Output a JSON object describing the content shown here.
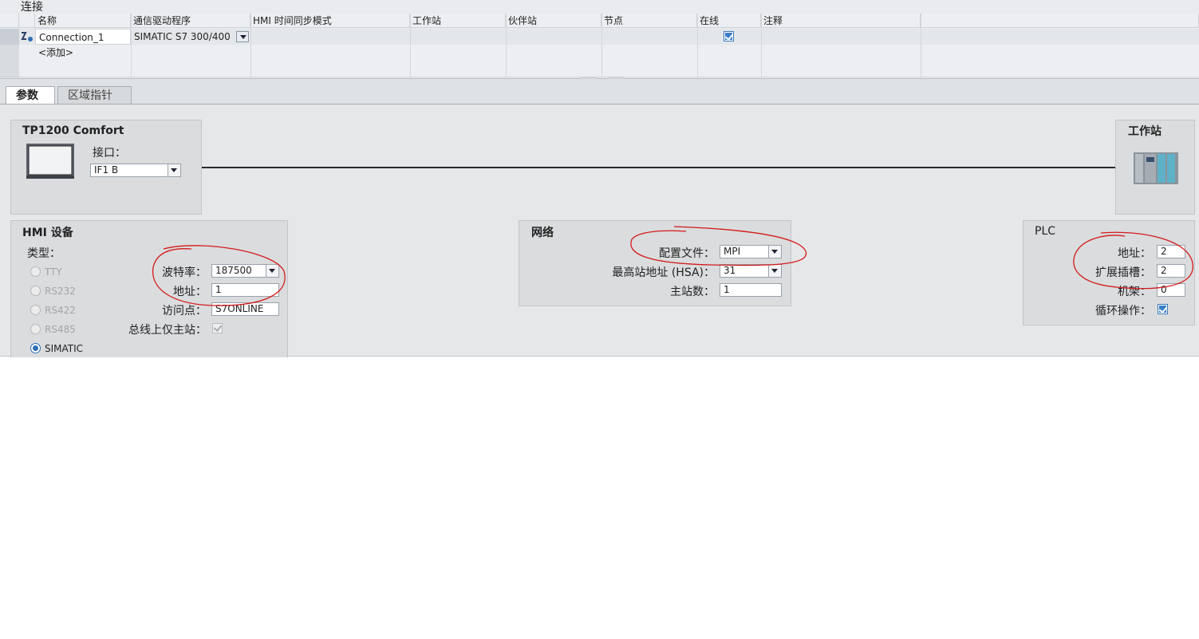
{
  "top": {
    "title": "连接",
    "columns": [
      "名称",
      "通信驱动程序",
      "HMI 时间同步模式",
      "工作站",
      "伙伴站",
      "节点",
      "在线",
      "注释"
    ],
    "rows": [
      {
        "name": "Connection_1",
        "driver": "SIMATIC S7 300/400",
        "online": true
      },
      {
        "name": "<添加>"
      }
    ]
  },
  "tabs": [
    {
      "label": "参数",
      "active": true
    },
    {
      "label": "区域指针",
      "active": false
    }
  ],
  "device": {
    "title": "TP1200 Comfort",
    "interface_label": "接口：",
    "interface_value": "IF1 B"
  },
  "station": {
    "title": "工作站"
  },
  "hmi": {
    "title": "HMI 设备",
    "type_label": "类型：",
    "types": [
      {
        "label": "TTY",
        "selected": false
      },
      {
        "label": "RS232",
        "selected": false
      },
      {
        "label": "RS422",
        "selected": false
      },
      {
        "label": "RS485",
        "selected": false
      },
      {
        "label": "SIMATIC",
        "selected": true
      }
    ],
    "baud_label": "波特率：",
    "baud_value": "187500",
    "address_label": "地址：",
    "address_value": "1",
    "access_label": "访问点：",
    "access_value": "S7ONLINE",
    "only_master_label": "总线上仅主站：",
    "only_master_checked": true
  },
  "network": {
    "title": "网络",
    "profile_label": "配置文件：",
    "profile_value": "MPI",
    "hsa_label": "最高站地址 (HSA)：",
    "hsa_value": "31",
    "masters_label": "主站数：",
    "masters_value": "1"
  },
  "plc": {
    "title": "PLC",
    "address_label": "地址：",
    "address_value": "2",
    "slot_label": "扩展插槽：",
    "slot_value": "2",
    "rack_label": "机架：",
    "rack_value": "0",
    "cyclic_label": "循环操作：",
    "cyclic_checked": true
  },
  "colors": {
    "annotation": "#d41a1a",
    "accent": "#2f6db3",
    "panel": "#dadcde"
  }
}
